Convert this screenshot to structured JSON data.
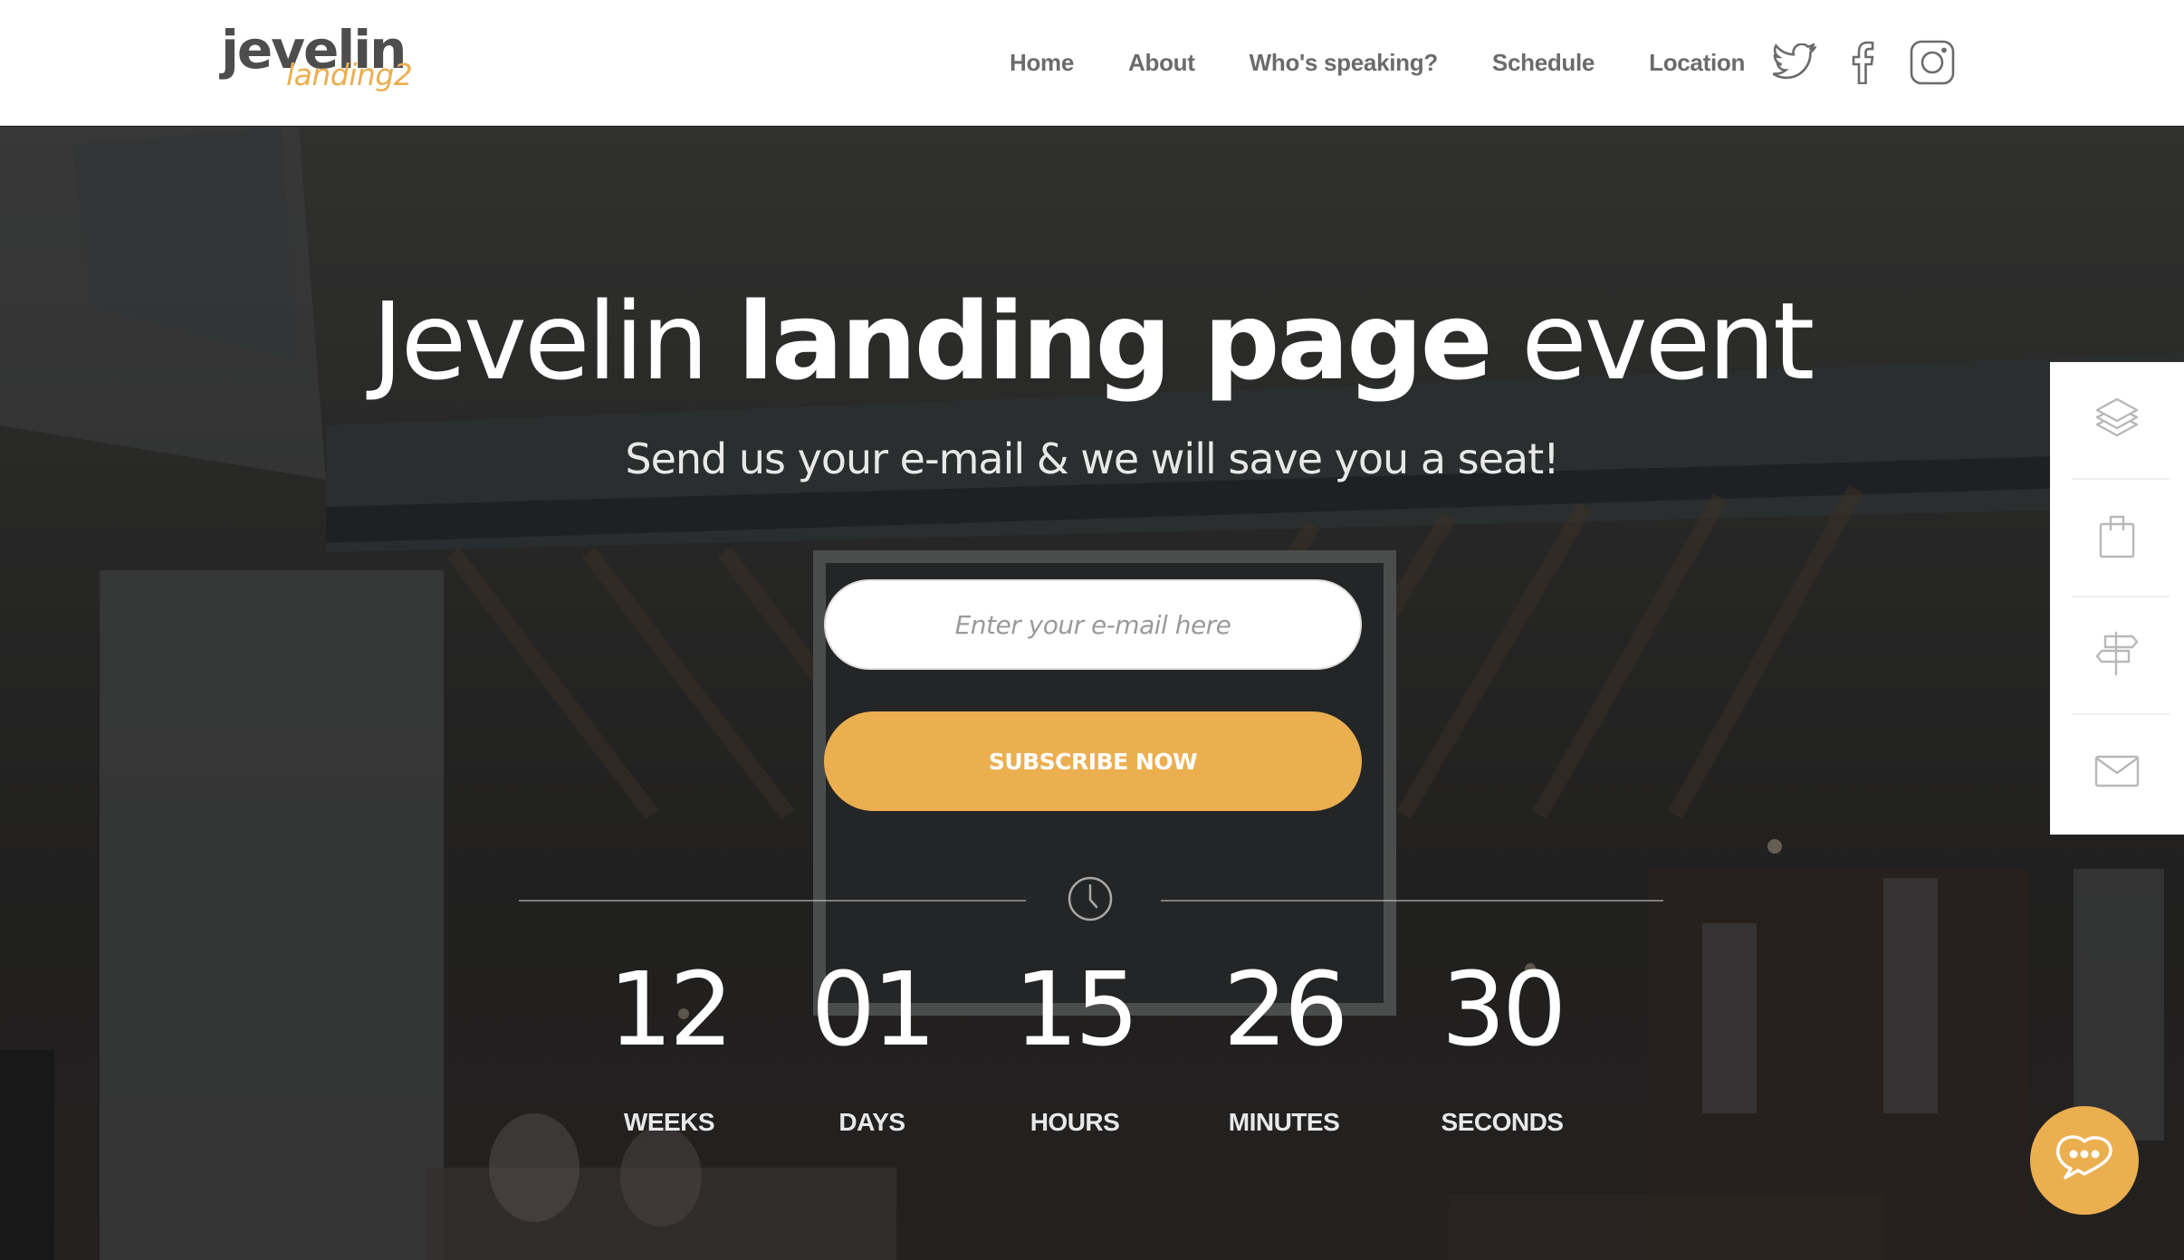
{
  "logo": {
    "main": "jevelin",
    "sub": "landing2"
  },
  "nav": {
    "items": [
      {
        "label": "Home"
      },
      {
        "label": "About"
      },
      {
        "label": "Who's speaking?"
      },
      {
        "label": "Schedule"
      },
      {
        "label": "Location"
      }
    ],
    "social": [
      {
        "icon": "twitter-icon"
      },
      {
        "icon": "facebook-icon"
      },
      {
        "icon": "instagram-icon"
      }
    ]
  },
  "hero": {
    "title_regular_1": "Jevelin ",
    "title_bold": "landing page",
    "title_regular_2": " event",
    "subtitle": "Send us your e-mail & we will save you a seat!",
    "email_placeholder": "Enter your e-mail here",
    "email_value": "",
    "subscribe_label": "SUBSCRIBE NOW"
  },
  "countdown": {
    "icon": "clock-icon",
    "units": [
      {
        "value": "12",
        "label": "WEEKS"
      },
      {
        "value": "01",
        "label": "DAYS"
      },
      {
        "value": "15",
        "label": "HOURS"
      },
      {
        "value": "26",
        "label": "MINUTES"
      },
      {
        "value": "30",
        "label": "SECONDS"
      }
    ]
  },
  "side_panel": {
    "items": [
      {
        "icon": "layers-icon"
      },
      {
        "icon": "shopping-bag-icon"
      },
      {
        "icon": "signpost-icon"
      },
      {
        "icon": "envelope-icon"
      }
    ]
  },
  "chat": {
    "icon": "chat-bubble-icon"
  },
  "colors": {
    "accent": "#ebaf50",
    "nav_text": "#6b6b6b",
    "logo_dark": "#4d4d4d",
    "side_icon": "#b8b8b8",
    "header_bg": "#ffffff"
  }
}
